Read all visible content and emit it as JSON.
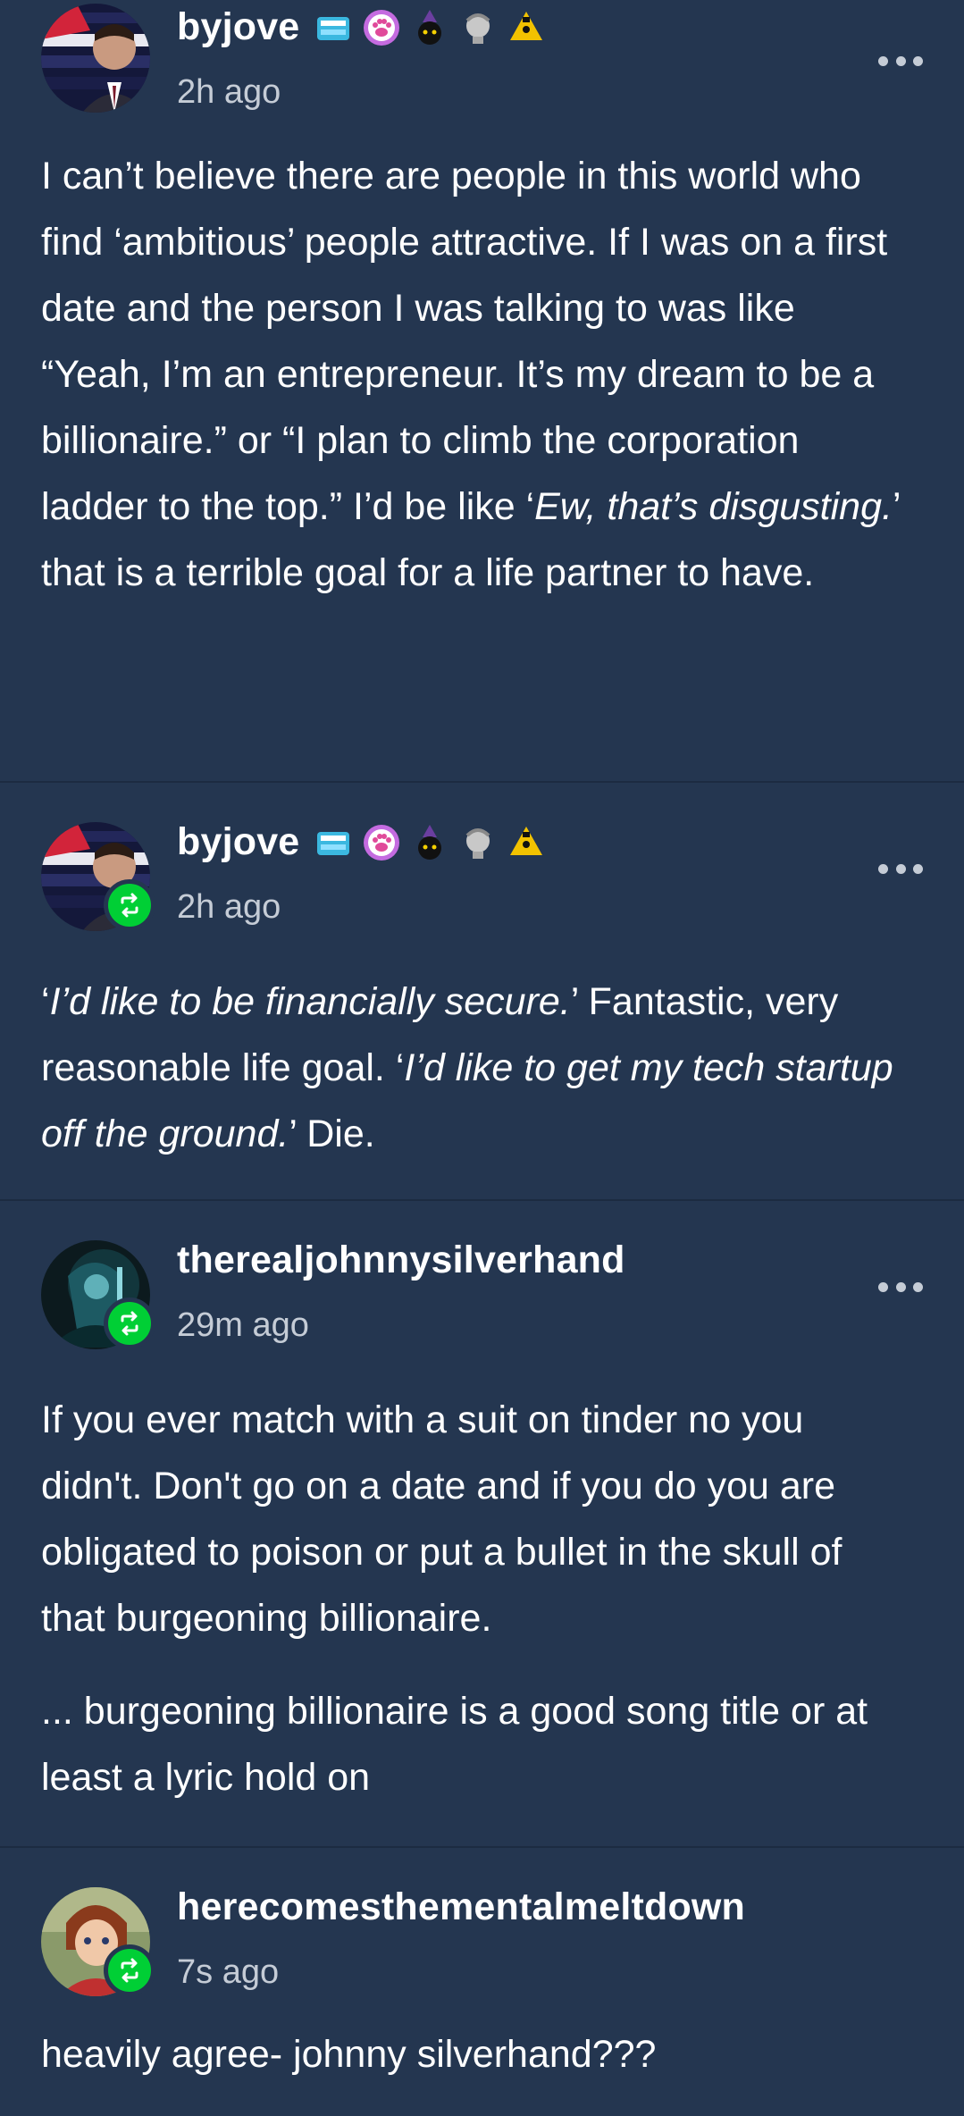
{
  "colors": {
    "background": "#243650",
    "divider": "#1c2b41",
    "text": "#ffffff",
    "muted_text": "#c5ccd6",
    "reblog_badge": "#00cf35"
  },
  "posts": [
    {
      "username": "byjove",
      "time": "2h ago",
      "reblogged": false,
      "badges": [
        "ice-cream-badge-icon",
        "paw-badge-icon",
        "witch-cat-badge-icon",
        "statue-badge-icon",
        "triangle-badge-icon"
      ],
      "paragraphs": [
        [
          {
            "text": "I can’t believe there are people in this world who find ‘ambitious’ people attractive. If I was on a first date and the person I was talking to was like “Yeah, I’m an entrepreneur. It’s my dream to be a billionaire.” or “I plan to climb the corporation ladder to the top.” I’d be like ‘"
          },
          {
            "text": "Ew, that’s disgusting.",
            "italic": true
          },
          {
            "text": "’ that is a terrible goal for a life partner to have."
          }
        ]
      ]
    },
    {
      "username": "byjove",
      "time": "2h ago",
      "reblogged": true,
      "badges": [
        "ice-cream-badge-icon",
        "paw-badge-icon",
        "witch-cat-badge-icon",
        "statue-badge-icon",
        "triangle-badge-icon"
      ],
      "paragraphs": [
        [
          {
            "text": "‘"
          },
          {
            "text": "I’d like to be financially secure.",
            "italic": true
          },
          {
            "text": "’ Fantastic, very reasonable life goal. ‘"
          },
          {
            "text": "I’d like to get my tech startup off the ground.",
            "italic": true
          },
          {
            "text": "’ Die."
          }
        ]
      ]
    },
    {
      "username": "therealjohnnysilverhand",
      "time": "29m ago",
      "reblogged": true,
      "badges": [],
      "paragraphs": [
        [
          {
            "text": "If you ever match with a suit on tinder no you didn't. Don't go on a date and if you do you are obligated to poison or put a bullet in the skull of that burgeoning billionaire."
          }
        ],
        [
          {
            "text": "... burgeoning billionaire is a good song title or at least a lyric hold on"
          }
        ]
      ]
    },
    {
      "username": "herecomesthementalmeltdown",
      "time": "7s ago",
      "reblogged": true,
      "badges": [],
      "paragraphs": [
        [
          {
            "text": "heavily agree- johnny silverhand???"
          }
        ]
      ]
    }
  ]
}
